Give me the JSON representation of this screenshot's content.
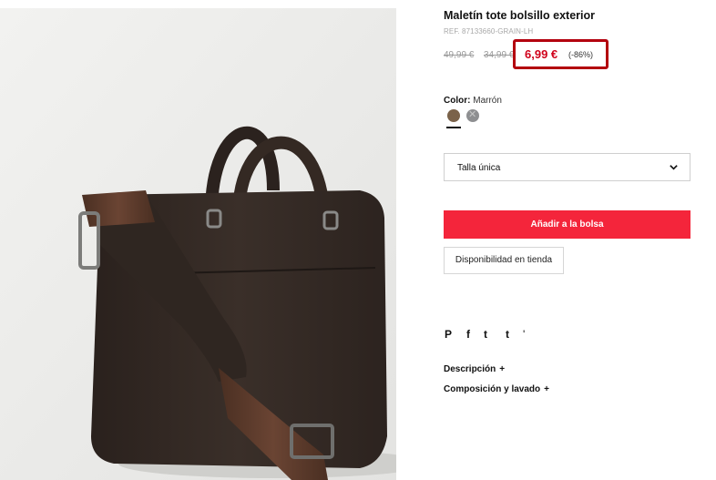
{
  "product": {
    "title": "Maletín tote bolsillo exterior",
    "ref": "REF. 87133660-GRAIN-LH",
    "old_price_1": "49,99 €",
    "old_price_2": "34,99 €",
    "price": "6,99 €",
    "discount": "(-86%)"
  },
  "color": {
    "label": "Color:",
    "value": "Marrón",
    "swatches": [
      "#7a624a",
      "#8e8f91"
    ]
  },
  "size": {
    "selected": "Talla única"
  },
  "actions": {
    "add_to_bag": "Añadir a la bolsa",
    "store_availability": "Disponibilidad en tienda"
  },
  "social": {
    "pinterest": "P",
    "facebook": "f",
    "twitter": "t",
    "tumblr": "t",
    "more": "'"
  },
  "accordions": {
    "description": "Descripción",
    "composition": "Composición y lavado",
    "plus": "+"
  },
  "colors": {
    "accent_red": "#f4253b",
    "price_red": "#d0021b",
    "highlight_border": "#b3000e"
  }
}
